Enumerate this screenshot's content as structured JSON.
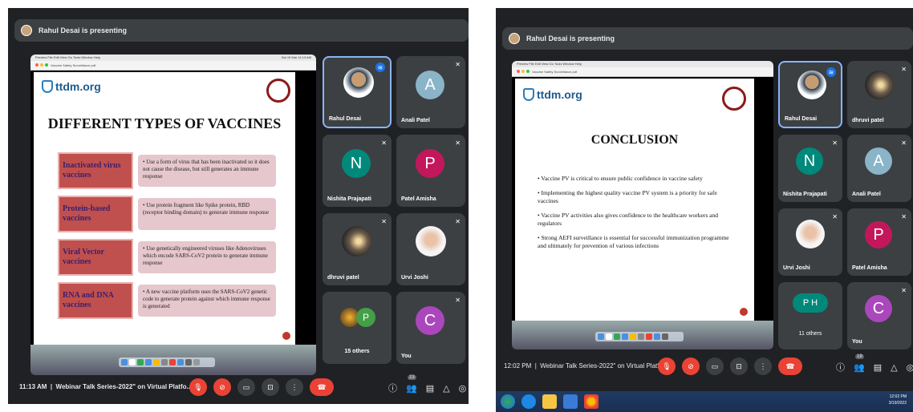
{
  "left": {
    "banner": "Rahul Desai is presenting",
    "mac_menu": "Preview  File  Edit  View  Go  Tools  Window  Help",
    "mac_status": "Sat 19 Mar 11:13 AM",
    "window_title": "Vaccine Safety Surveillance.pdf",
    "window_sub": "Page 43 of 59",
    "logo": "ttdm.org",
    "slide_title": "DIFFERENT TYPES OF VACCINES",
    "rows": [
      {
        "label": "Inactivated virus vaccines",
        "desc": "• Use a form of virus that has been inactivated so it does not cause the disease, but still generates an immune response"
      },
      {
        "label": "Protein-based vaccines",
        "desc": "• Use protein fragment like Spike protein, RBD (receptor binding domain) to generate immune response"
      },
      {
        "label": "Viral Vector vaccines",
        "desc": "• Use genetically engineered viruses like Adenoviruses which encode SARS-CoV2 protein to generate immune response"
      },
      {
        "label": "RNA and DNA vaccines",
        "desc": "• A new vaccine platform uses the SARS-CoV2 genetic code to generate protein against which immune response is generated"
      }
    ],
    "participants": [
      {
        "name": "Rahul Desai",
        "kind": "photo"
      },
      {
        "name": "Anali Patel",
        "initial": "A",
        "color": "#8ab4c8"
      },
      {
        "name": "Nishita Prajapati",
        "initial": "N",
        "color": "#00897b"
      },
      {
        "name": "Patel Amisha",
        "initial": "P",
        "color": "#c2185b"
      },
      {
        "name": "dhruvi patel",
        "kind": "photo"
      },
      {
        "name": "Urvi Joshi",
        "kind": "photo"
      },
      {
        "name": "15 others",
        "initial": "P",
        "color": "#43a047"
      },
      {
        "name": "You",
        "initial": "C",
        "color": "#ab47bc"
      }
    ],
    "time": "11:13 AM",
    "meeting": "Webinar Talk Series-2022\" on Virtual Platfo...",
    "people_count": "23"
  },
  "right": {
    "banner": "Rahul Desai is presenting",
    "logo": "ttdm.org",
    "slide_title": "CONCLUSION",
    "bullets": [
      "• Vaccine PV is critical to ensure public confidence in vaccine safety",
      "• Implementing the highest quality vaccine PV system is a priority for safe vaccines",
      "• Vaccine PV activities also gives confidence to the healthcare workers and regulators",
      "• Strong AEFI surveillance is essential for successful immunization programme and ultimately for prevention of various infections"
    ],
    "participants": [
      {
        "name": "Rahul Desai",
        "kind": "photo"
      },
      {
        "name": "dhruvi patel",
        "kind": "photo"
      },
      {
        "name": "Nishita Prajapati",
        "initial": "N",
        "color": "#00897b"
      },
      {
        "name": "Anali Patel",
        "initial": "A",
        "color": "#8ab4c8"
      },
      {
        "name": "Urvi Joshi",
        "kind": "photo"
      },
      {
        "name": "Patel Amisha",
        "initial": "P",
        "color": "#c2185b"
      },
      {
        "name": "11 others",
        "initial": "P H",
        "color": "#00897b"
      },
      {
        "name": "You",
        "initial": "C",
        "color": "#ab47bc"
      }
    ],
    "time": "12:02 PM",
    "meeting": "Webinar Talk Series-2022\" on Virtual Platf...",
    "people_count": "19",
    "tray_time": "12:02 PM",
    "tray_date": "3/19/2022"
  }
}
